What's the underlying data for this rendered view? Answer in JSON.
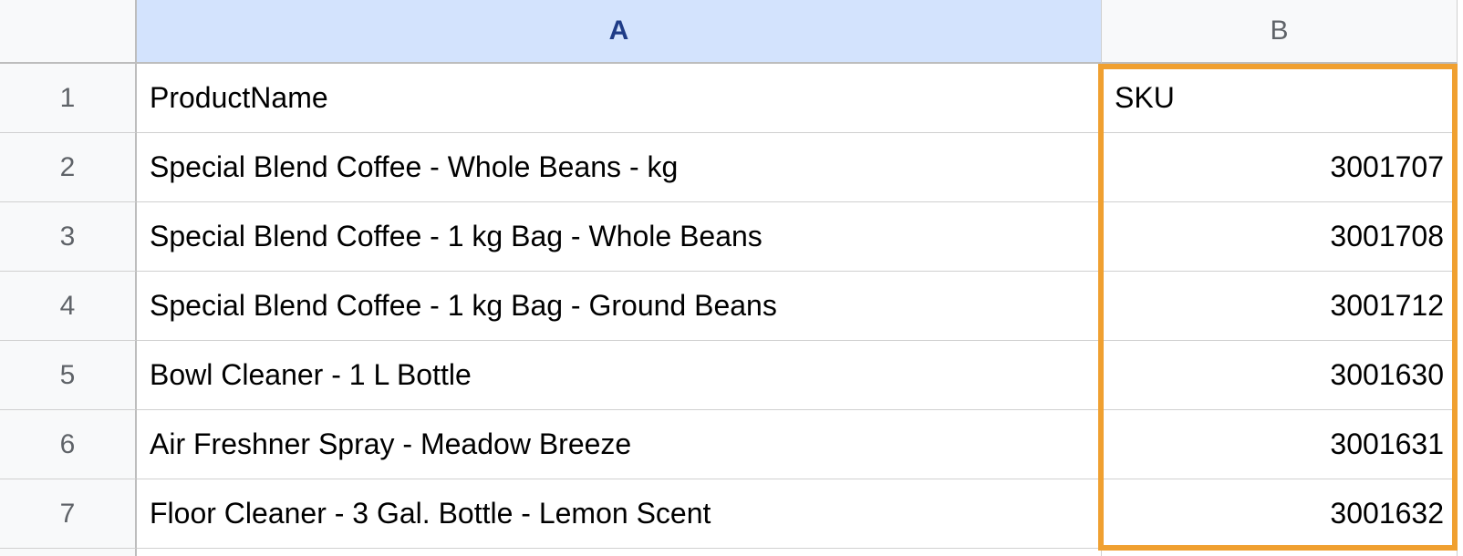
{
  "columns": {
    "a": "A",
    "b": "B"
  },
  "rowNumbers": [
    "1",
    "2",
    "3",
    "4",
    "5",
    "6",
    "7"
  ],
  "headers": {
    "a": "ProductName",
    "b": "SKU"
  },
  "rows": [
    {
      "product": "Special Blend Coffee - Whole Beans - kg",
      "sku": "3001707"
    },
    {
      "product": "Special Blend Coffee - 1 kg Bag - Whole Beans",
      "sku": "3001708"
    },
    {
      "product": "Special Blend Coffee - 1 kg Bag - Ground Beans",
      "sku": "3001712"
    },
    {
      "product": "Bowl Cleaner - 1 L Bottle",
      "sku": "3001630"
    },
    {
      "product": "Air Freshner Spray - Meadow Breeze",
      "sku": "3001631"
    },
    {
      "product": "Floor Cleaner - 3 Gal. Bottle - Lemon Scent",
      "sku": "3001632"
    }
  ],
  "selectedColumn": "A"
}
